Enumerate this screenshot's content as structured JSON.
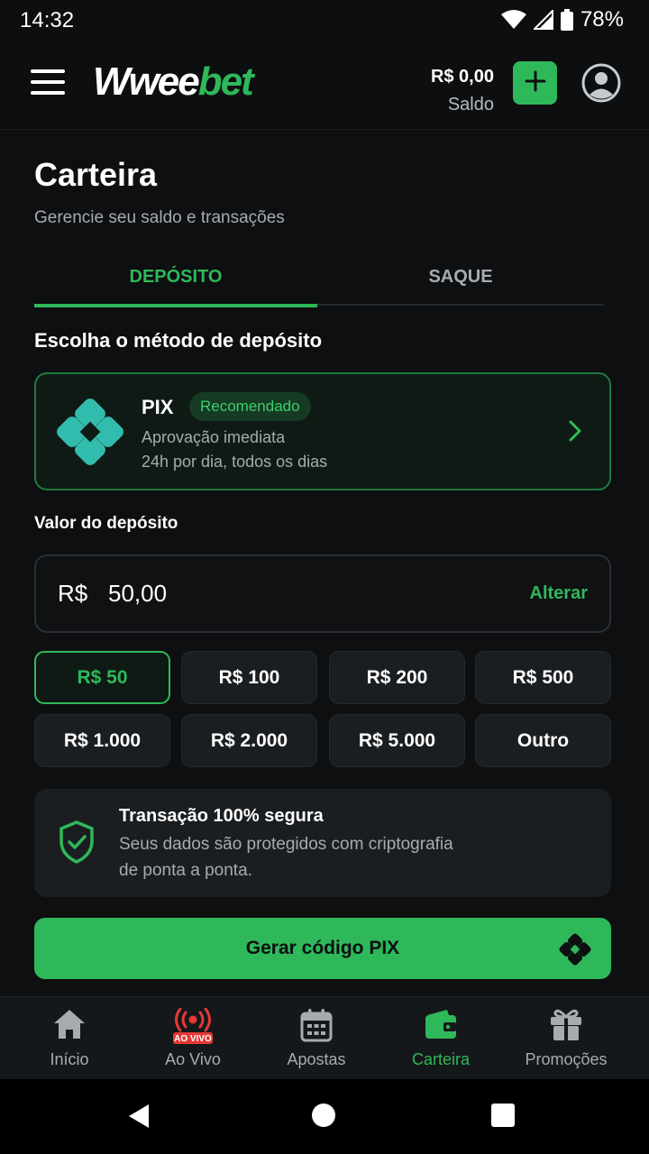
{
  "status_bar": {
    "time": "14:32",
    "battery": "78%"
  },
  "header": {
    "logo_part1": "Wwee",
    "logo_part2": "bet",
    "balance_value": "R$ 0,00",
    "balance_label": "Saldo"
  },
  "page": {
    "title": "Carteira",
    "subtitle": "Gerencie seu saldo e transações"
  },
  "tabs": [
    {
      "label": "DEPÓSITO",
      "active": true
    },
    {
      "label": "SAQUE",
      "active": false
    }
  ],
  "deposit": {
    "method_title": "Escolha o método de depósito",
    "method": {
      "name": "PIX",
      "badge": "Recomendado",
      "line1": "Aprovação imediata",
      "line2": "24h por dia, todos os dias"
    },
    "value_label": "Valor do depósito",
    "currency": "R$",
    "amount": "50,00",
    "change_label": "Alterar",
    "quick_amounts": [
      {
        "label": "R$ 50",
        "selected": true
      },
      {
        "label": "R$ 100",
        "selected": false
      },
      {
        "label": "R$ 200",
        "selected": false
      },
      {
        "label": "R$ 500",
        "selected": false
      },
      {
        "label": "R$ 1.000",
        "selected": false
      },
      {
        "label": "R$ 2.000",
        "selected": false
      },
      {
        "label": "R$ 5.000",
        "selected": false
      },
      {
        "label": "Outro",
        "selected": false
      }
    ],
    "secure": {
      "title": "Transação 100% segura",
      "line1": "Seus dados são protegidos com criptografia",
      "line2": "de ponta a ponta."
    },
    "cta_label": "Gerar código PIX"
  },
  "bottom_nav": [
    {
      "label": "Início",
      "icon": "home-icon",
      "active": false
    },
    {
      "label": "Ao Vivo",
      "icon": "live-icon",
      "badge": "AO VIVO",
      "active": false
    },
    {
      "label": "Apostas",
      "icon": "calendar-icon",
      "active": false
    },
    {
      "label": "Carteira",
      "icon": "wallet-icon",
      "active": true
    },
    {
      "label": "Promoções",
      "icon": "gift-icon",
      "active": false
    }
  ],
  "colors": {
    "accent": "#2fb85a",
    "background": "#0d0f10",
    "card": "#1b1e21",
    "pix": "#32bcad",
    "live_badge": "#e53935"
  }
}
